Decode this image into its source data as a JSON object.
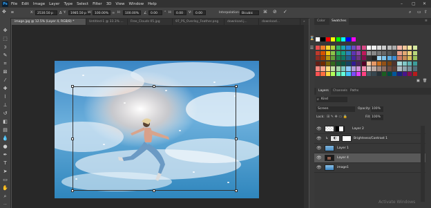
{
  "app": {
    "logo": "Ps"
  },
  "menu": [
    "File",
    "Edit",
    "Image",
    "Layer",
    "Type",
    "Select",
    "Filter",
    "3D",
    "View",
    "Window",
    "Help"
  ],
  "options_bar": {
    "x_label": "X:",
    "x_value": "2530.50 p",
    "y_label": "Y:",
    "y_value": "1985.50 p",
    "w_label": "W:",
    "w_value": "100.00%",
    "h_label": "H:",
    "h_value": "100.00%",
    "angle_value": "0.00",
    "h_skew_label": "H:",
    "h_skew_value": "0.00",
    "v_skew_label": "V:",
    "v_skew_value": "0.00",
    "interpolation_label": "Interpolation:",
    "interpolation_value": "Bicubic"
  },
  "tabs": [
    {
      "label": "image.jpg @ 12.5% (Layer 4, RGB/8) *"
    },
    {
      "label": "Untitled-1 @ 33.3% ..."
    },
    {
      "label": "Free_Clouds 05.jpg"
    },
    {
      "label": "97_PS_Overlay_Feather.png"
    },
    {
      "label": "download.j..."
    },
    {
      "label": "download..."
    }
  ],
  "color_panel": {
    "tab_color": "Color",
    "tab_swatches": "Swatches"
  },
  "layers_panel": {
    "tab_layers": "Layers",
    "tab_channels": "Channels",
    "tab_paths": "Paths",
    "kind_label": "Kind",
    "blend_mode": "Screen",
    "opacity_label": "Opacity:",
    "opacity_value": "100%",
    "lock_label": "Lock:",
    "fill_label": "Fill:",
    "fill_value": "100%",
    "layers": [
      {
        "name": "Layer 2"
      },
      {
        "name": "Brightness/Contrast 1"
      },
      {
        "name": "Layer 1"
      },
      {
        "name": "Layer 4"
      },
      {
        "name": "image1"
      }
    ]
  },
  "watermark": "Activate Windows",
  "colors": {
    "accent": "#31a8ff",
    "panel_bg": "#383838",
    "canvas_bg": "#282828"
  }
}
